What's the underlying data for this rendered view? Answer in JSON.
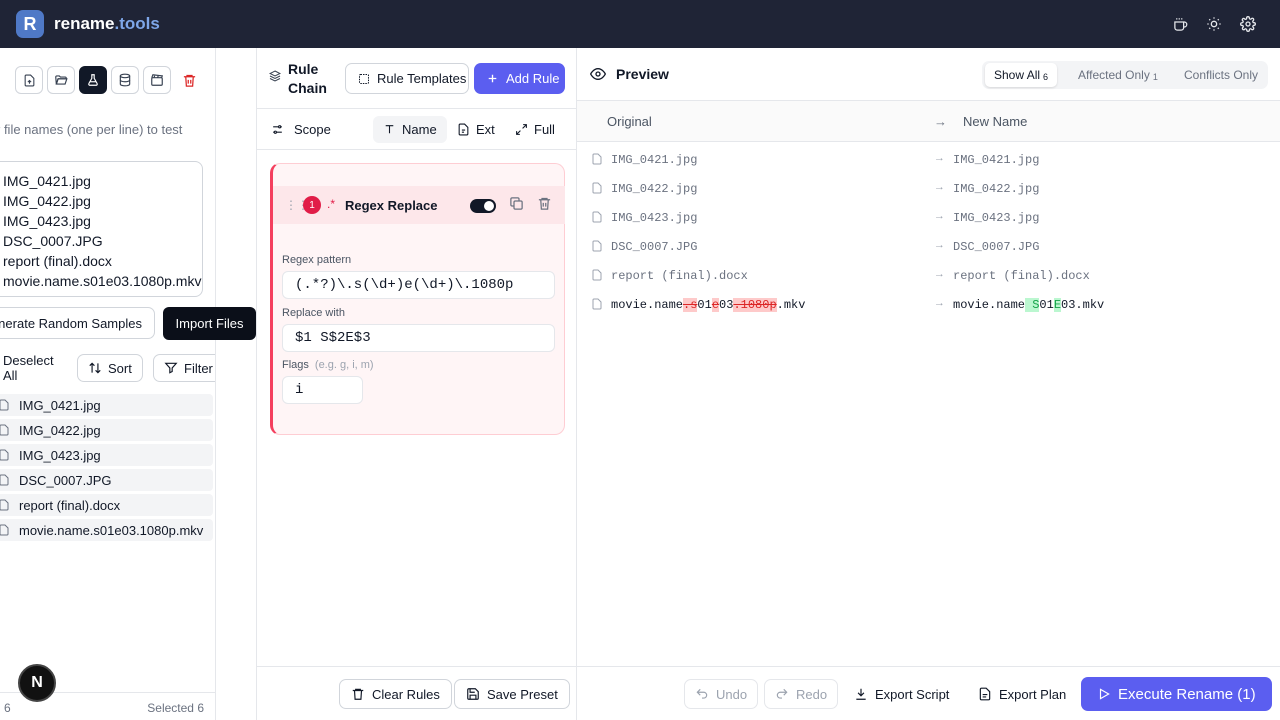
{
  "header": {
    "logo_letter": "R",
    "brand_main": "rename",
    "brand_accent": ".tools",
    "icons": [
      "coffee-icon",
      "sun-icon",
      "gear-icon"
    ]
  },
  "left": {
    "hint": "r file names (one per line) to test",
    "textarea_lines": [
      "IMG_0421.jpg",
      "IMG_0422.jpg",
      "IMG_0423.jpg",
      "DSC_0007.JPG",
      "report (final).docx",
      "movie.name.s01e03.1080p.mkv"
    ],
    "generate_label": "Generate Random Samples",
    "import_tooltip": "Import Files",
    "deselect_label": "Deselect All",
    "sort_label": "Sort",
    "filter_label": "Filter",
    "files": [
      "IMG_0421.jpg",
      "IMG_0422.jpg",
      "IMG_0423.jpg",
      "DSC_0007.JPG",
      "report (final).docx",
      "movie.name.s01e03.1080p.mkv"
    ],
    "count": "6",
    "selected": "Selected 6",
    "badge": "N"
  },
  "rules": {
    "title": "Rule Chain",
    "templates_label": "Rule Templates",
    "add_label": "Add Rule",
    "scope_label": "Scope",
    "scope_name": "Name",
    "scope_ext": "Ext",
    "scope_full": "Full",
    "rule": {
      "number": "1",
      "type_icon": ".*",
      "name": "Regex Replace",
      "pattern_label": "Regex pattern",
      "pattern_value": "(.*?)\\.s(\\d+)e(\\d+)\\.1080p",
      "replace_label": "Replace with",
      "replace_value": "$1 S$2E$3",
      "flags_label": "Flags",
      "flags_placeholder": "(e.g. g, i, m)",
      "flags_value": "i"
    },
    "clear_label": "Clear Rules",
    "save_label": "Save Preset"
  },
  "preview": {
    "title": "Preview",
    "show_all": "Show All",
    "show_all_count": "6",
    "affected_only": "Affected Only",
    "affected_count": "1",
    "conflicts_only": "Conflicts Only",
    "col_original": "Original",
    "col_arrow": "→",
    "col_new": "New Name",
    "rows": [
      {
        "orig": "IMG_0421.jpg",
        "new": "IMG_0421.jpg"
      },
      {
        "orig": "IMG_0422.jpg",
        "new": "IMG_0422.jpg"
      },
      {
        "orig": "IMG_0423.jpg",
        "new": "IMG_0423.jpg"
      },
      {
        "orig": "DSC_0007.JPG",
        "new": "DSC_0007.JPG"
      },
      {
        "orig": "report (final).docx",
        "new": "report (final).docx"
      }
    ],
    "changed_row": {
      "orig_parts": [
        "movie.name",
        ".s",
        "01",
        "e",
        "03",
        ".1080p",
        ".mkv"
      ],
      "new_parts": [
        "movie.name",
        " S",
        "01",
        "E",
        "03.mkv"
      ]
    },
    "undo_label": "Undo",
    "redo_label": "Redo",
    "export_script_label": "Export Script",
    "export_plan_label": "Export Plan",
    "execute_label": "Execute Rename (1)"
  }
}
